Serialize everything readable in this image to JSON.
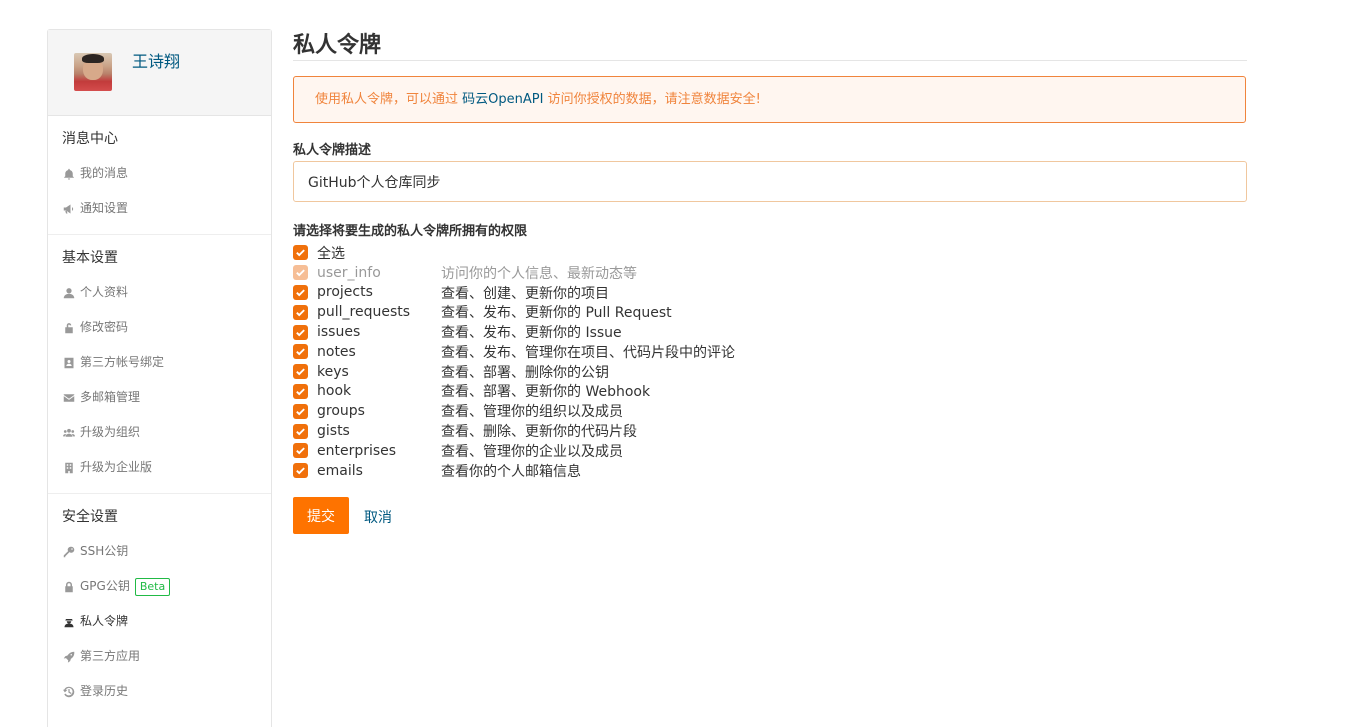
{
  "sidebar": {
    "username": "王诗翔",
    "sections": [
      {
        "title": "消息中心",
        "items": [
          {
            "label": "我的消息",
            "icon": "bell-icon"
          },
          {
            "label": "通知设置",
            "icon": "megaphone-icon"
          }
        ]
      },
      {
        "title": "基本设置",
        "items": [
          {
            "label": "个人资料",
            "icon": "user-icon"
          },
          {
            "label": "修改密码",
            "icon": "unlock-icon"
          },
          {
            "label": "第三方帐号绑定",
            "icon": "id-card-icon"
          },
          {
            "label": "多邮箱管理",
            "icon": "envelope-icon"
          },
          {
            "label": "升级为组织",
            "icon": "users-icon"
          },
          {
            "label": "升级为企业版",
            "icon": "building-icon"
          }
        ]
      },
      {
        "title": "安全设置",
        "items": [
          {
            "label": "SSH公钥",
            "icon": "key-icon"
          },
          {
            "label": "GPG公钥",
            "icon": "lock-icon",
            "badge": "Beta"
          },
          {
            "label": "私人令牌",
            "icon": "user-secret-icon",
            "active": true
          },
          {
            "label": "第三方应用",
            "icon": "rocket-icon"
          },
          {
            "label": "登录历史",
            "icon": "history-icon"
          }
        ]
      }
    ]
  },
  "main": {
    "title": "私人令牌",
    "alert": {
      "before": "使用私人令牌，可以通过 ",
      "link": "码云OpenAPI",
      "after": " 访问你授权的数据，请注意数据安全!"
    },
    "desc_label": "私人令牌描述",
    "desc_value": "GitHub个人仓库同步",
    "perms_label": "请选择将要生成的私人令牌所拥有的权限",
    "select_all": "全选",
    "permissions": [
      {
        "name": "user_info",
        "desc": "访问你的个人信息、最新动态等",
        "checked": true,
        "disabled": true
      },
      {
        "name": "projects",
        "desc": "查看、创建、更新你的项目",
        "checked": true
      },
      {
        "name": "pull_requests",
        "desc": "查看、发布、更新你的 Pull Request",
        "checked": true
      },
      {
        "name": "issues",
        "desc": "查看、发布、更新你的 Issue",
        "checked": true
      },
      {
        "name": "notes",
        "desc": "查看、发布、管理你在项目、代码片段中的评论",
        "checked": true
      },
      {
        "name": "keys",
        "desc": "查看、部署、删除你的公钥",
        "checked": true
      },
      {
        "name": "hook",
        "desc": "查看、部署、更新你的 Webhook",
        "checked": true
      },
      {
        "name": "groups",
        "desc": "查看、管理你的组织以及成员",
        "checked": true
      },
      {
        "name": "gists",
        "desc": "查看、删除、更新你的代码片段",
        "checked": true
      },
      {
        "name": "enterprises",
        "desc": "查看、管理你的企业以及成员",
        "checked": true
      },
      {
        "name": "emails",
        "desc": "查看你的个人邮箱信息",
        "checked": true
      }
    ],
    "submit_label": "提交",
    "cancel_label": "取消"
  },
  "colors": {
    "accent": "#fe7300",
    "checkbox": "#f0700b",
    "link": "#005980",
    "alert_text": "#f0843c",
    "beta": "#21ba45"
  }
}
